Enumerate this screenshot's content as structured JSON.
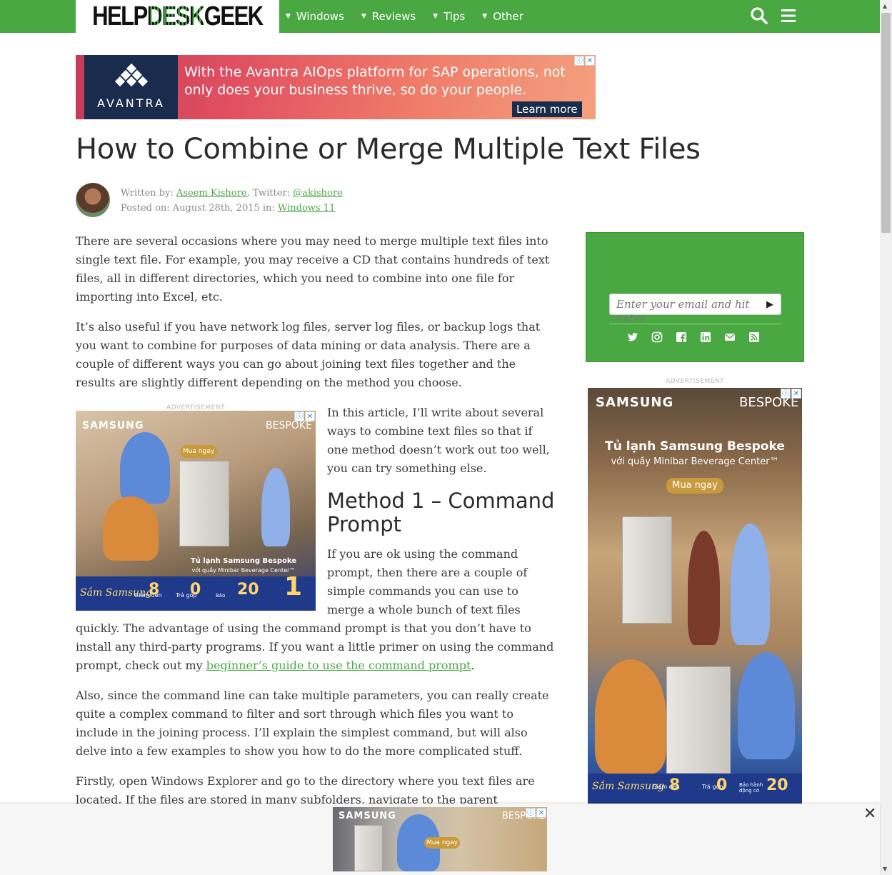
{
  "header": {
    "logo_left": "HELP",
    "logo_mid": "DESK",
    "logo_right": "GEEK",
    "nav": [
      "Windows",
      "Reviews",
      "Tips",
      "Other"
    ]
  },
  "top_ad": {
    "brand": "AVANTRA",
    "text": "With the Avantra AIOps platform for SAP operations, not only does your business thrive, so do your people.",
    "cta": "Learn more"
  },
  "article": {
    "title": "How to Combine or Merge Multiple Text Files",
    "written_by_label": "Written by: ",
    "author": "Aseem Kishore",
    "twitter_label": ", Twitter: ",
    "twitter": "@akishore",
    "posted_label": "Posted on: August 28th, 2015 in: ",
    "category": "Windows 11",
    "p1": "There are several occasions where you may need to merge multiple text files into single text file. For example, you may receive a CD that contains hundreds of text files, all in different directories, which you need to combine into one file for importing into Excel, etc.",
    "p2": "It’s also useful if you have network log files, server log files, or backup logs that you want to combine for purposes of data mining or data analysis. There are a couple of different ways you can go about joining text files together and the results are slightly different depending on the method you choose.",
    "p3": "In this article, I’ll write about several ways to combine text files so that if one method doesn’t work out too well, you can try something else.",
    "h2": "Method 1 – Command Prompt",
    "p4_start": "If you are ok using the command prompt, then there are a couple of simple commands you can use to merge a whole bunch of text files quickly. The advantage of using the command prompt is that you don’t have to install any third-party programs. If you want a little primer on using the command prompt, check out my ",
    "p4_link": "beginner’s guide to use the command prompt",
    "p4_end": ".",
    "p5": "Also, since the command line can take multiple parameters, you can really create quite a complex command to filter and sort through which files you want to include in the joining process. I’ll explain the simplest command, but will also delve into a few examples to show you how to do the more complicated stuff.",
    "p6": "Firstly, open Windows Explorer and go to the directory where you text files are located. If the files are stored in many subfolders, navigate to the parent directory. Now press and"
  },
  "ads": {
    "label": "ADVERTISEMENT",
    "samsung": "SAMSUNG",
    "bespoke": "BESPOKE",
    "inline_cta": "Mua ngay",
    "inline_tagline_1": "Tủ lạnh Samsung Bespoke",
    "inline_tagline_2": "với quầy Minibar Beverage Center™",
    "side_tagline_1": "Tủ lạnh Samsung Bespoke",
    "side_tagline_2": "với quầy Minibar Beverage Center™",
    "side_cta": "Mua ngay",
    "promo_brand": "Sắm Samsung",
    "promo_1_num": "8",
    "promo_1_label": "Giảm đến",
    "promo_2_num": "0",
    "promo_2_label": "Trả góp",
    "promo_3_num": "20",
    "promo_3_label": "Bảo hành động cơ",
    "badge": "1"
  },
  "sidebar": {
    "email_placeholder": "Enter your email and hit enter"
  }
}
